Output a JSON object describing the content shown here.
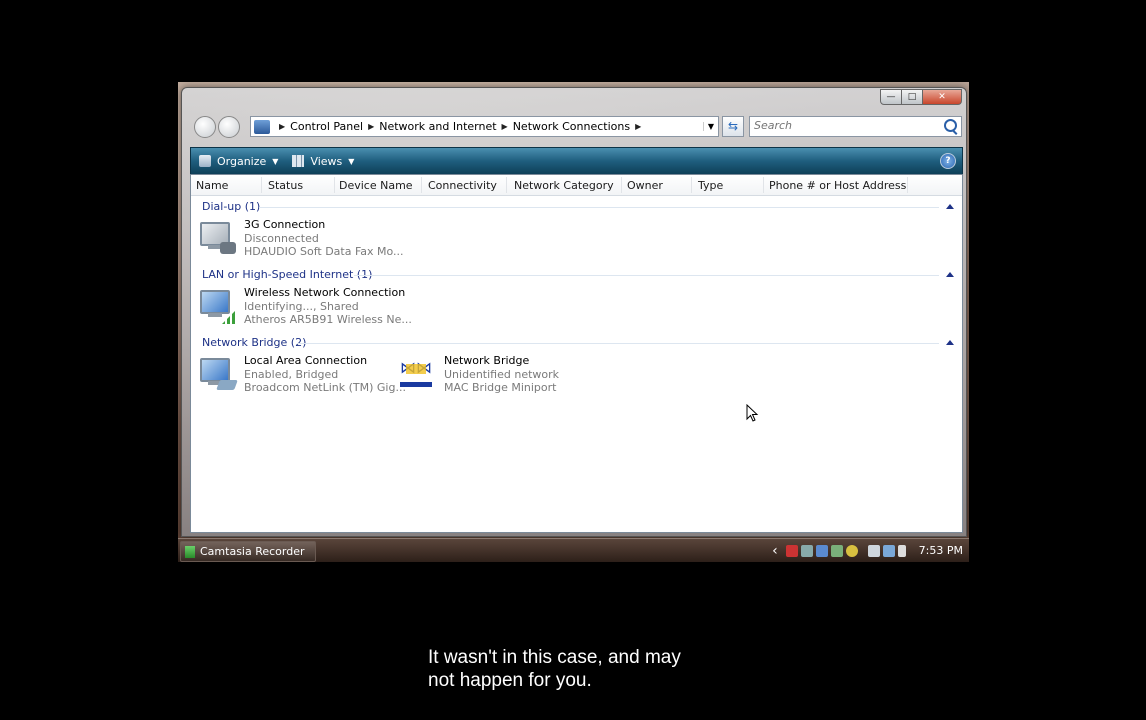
{
  "window": {
    "caption": {
      "min": "—",
      "max": "□",
      "close": "✕"
    }
  },
  "address_bar": {
    "crumbs": [
      "Control Panel",
      "Network and Internet",
      "Network Connections"
    ]
  },
  "search": {
    "placeholder": "Search"
  },
  "command_bar": {
    "organize_label": "Organize",
    "views_label": "Views",
    "help_label": "?"
  },
  "columns": [
    "Name",
    "Status",
    "Device Name",
    "Connectivity",
    "Network Category",
    "Owner",
    "Type",
    "Phone # or Host Address"
  ],
  "groups": [
    {
      "title": "Dial-up (1)",
      "items": [
        {
          "name": "3G Connection",
          "status": "Disconnected",
          "device": "HDAUDIO Soft Data Fax Mo...",
          "icon": "dialup-modem-icon"
        }
      ]
    },
    {
      "title": "LAN or High-Speed Internet (1)",
      "items": [
        {
          "name": "Wireless Network Connection",
          "status": "Identifying..., Shared",
          "device": "Atheros AR5B91 Wireless Ne...",
          "icon": "wireless-network-icon"
        }
      ]
    },
    {
      "title": "Network Bridge (2)",
      "items": [
        {
          "name": "Local Area Connection",
          "status": "Enabled, Bridged",
          "device": "Broadcom NetLink (TM) Gig...",
          "icon": "lan-network-icon"
        },
        {
          "name": "Network Bridge",
          "status": "Unidentified network",
          "device": "MAC Bridge Miniport",
          "icon": "network-bridge-icon"
        }
      ]
    }
  ],
  "taskbar": {
    "task_label": "Camtasia Recorder",
    "tray_back": "‹",
    "clock": "7:53 PM"
  },
  "subtitle": {
    "lines": [
      "It wasn't in this case, and may",
      "not happen for you."
    ]
  },
  "colors": {
    "command_bar": "#1f5e7e",
    "group_title": "#1e3287",
    "secondary_text": "#7a7a7a"
  }
}
